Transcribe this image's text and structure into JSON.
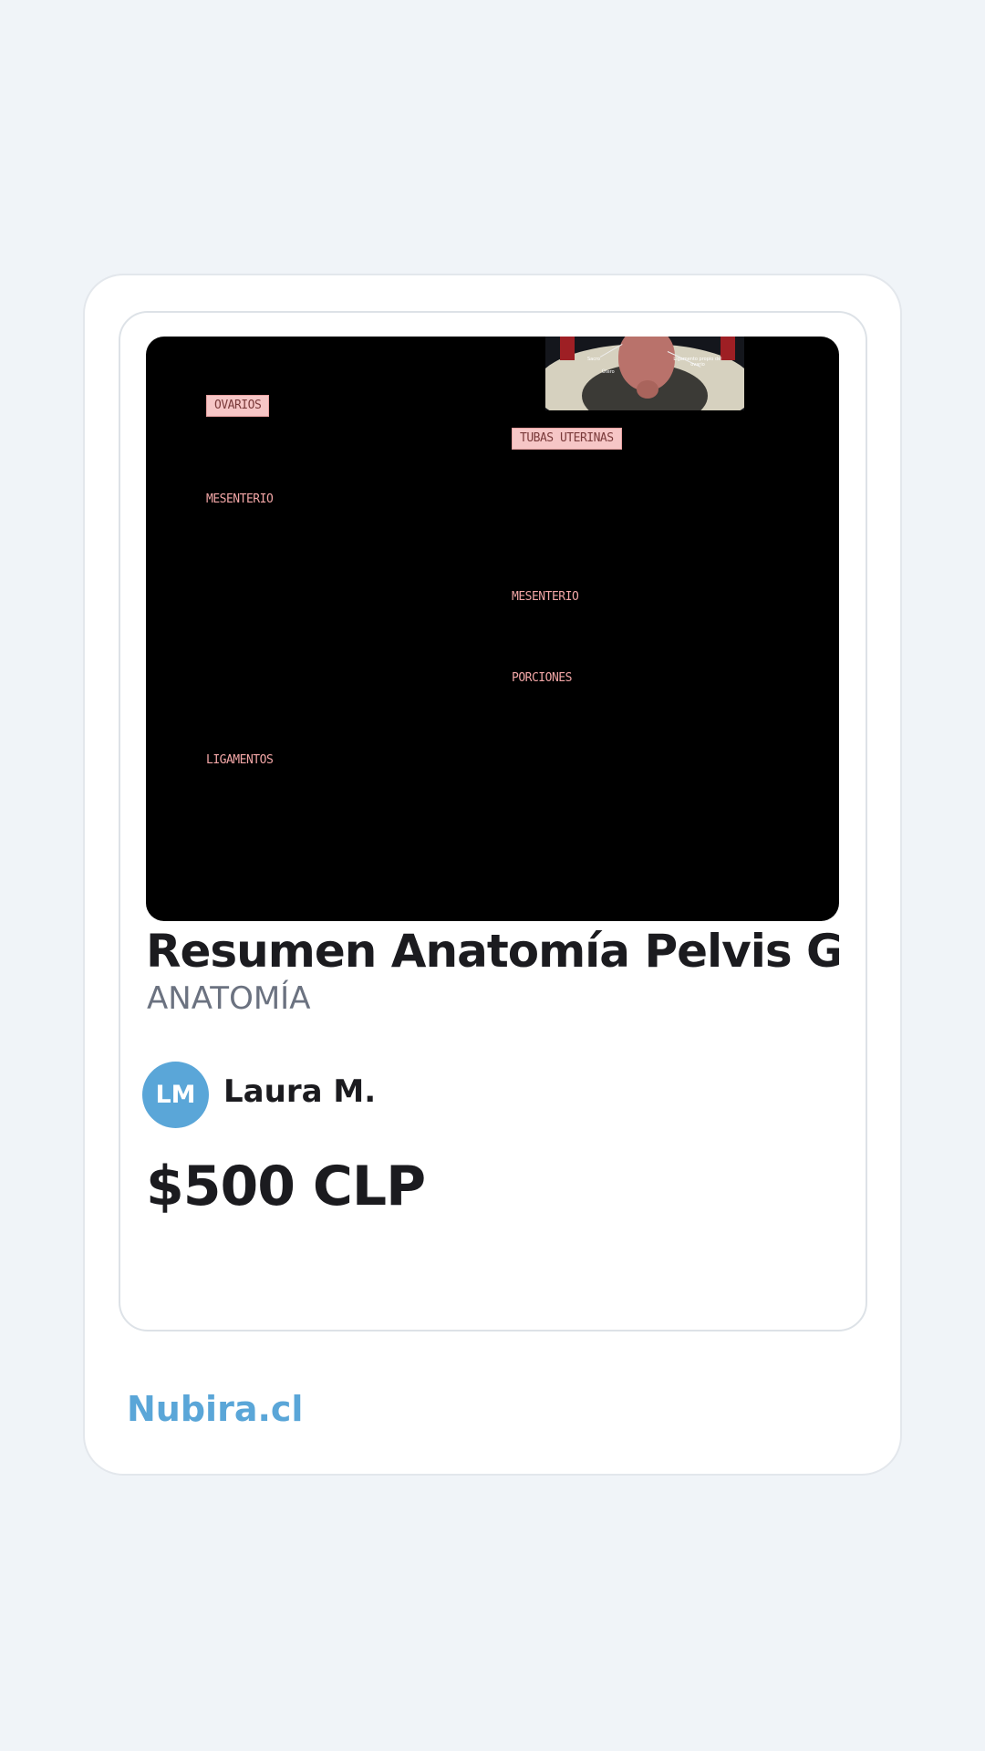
{
  "listing": {
    "preview": {
      "thumbnail_captions": [
        "Sacro",
        "Útero",
        "Ligamento propio del ovario"
      ],
      "labels": {
        "ovarios": "OVARIOS",
        "tubas_uterinas": "TUBAS UTERINAS",
        "mesenterio_left": "MESENTERIO",
        "mesenterio_right": "MESENTERIO",
        "porciones": "PORCIONES",
        "ligamentos": "LIGAMENTOS"
      }
    },
    "title": "Resumen Anatomía Pelvis G...",
    "category": "ANATOMÍA",
    "author": {
      "initials": "LM",
      "name": "Laura M."
    },
    "price": "$500 CLP"
  },
  "footer": {
    "brand": "Nubira.cl"
  },
  "colors": {
    "background": "#f0f4f8",
    "brand_blue": "#5aa6d8",
    "text_dark": "#1b1b1f",
    "text_muted": "#6b7280",
    "preview_label_pink": "#f6c6c6"
  }
}
